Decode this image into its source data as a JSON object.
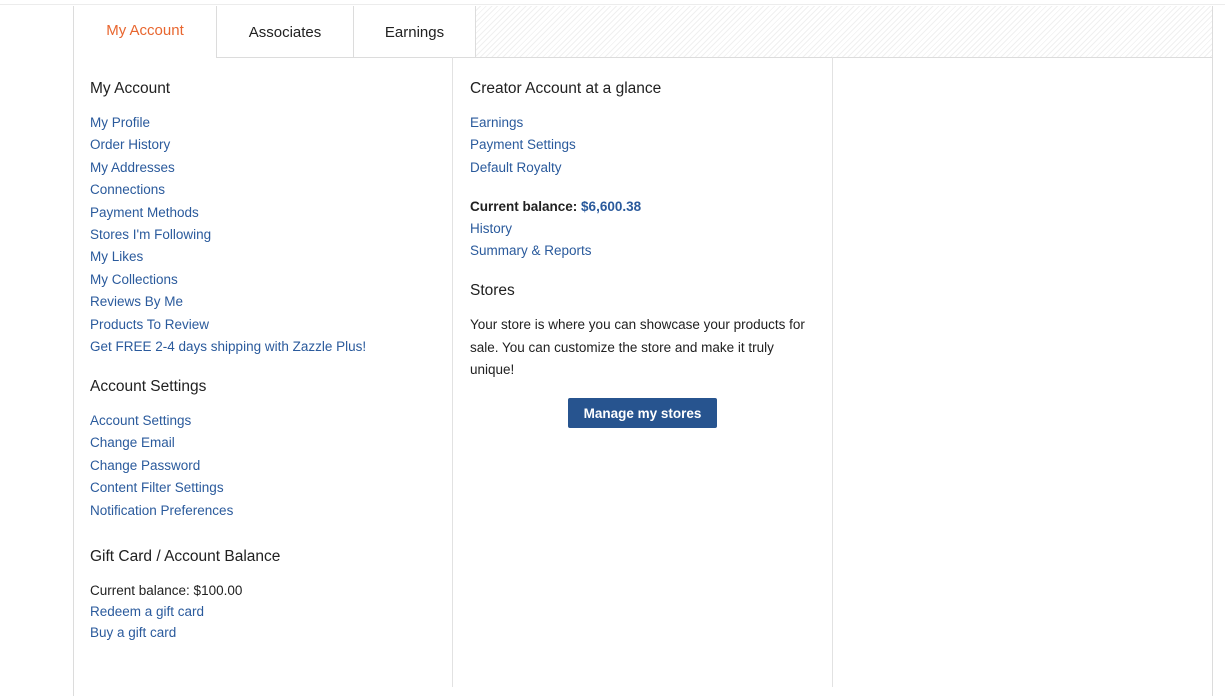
{
  "tabs": {
    "my_account": "My Account",
    "associates": "Associates",
    "earnings": "Earnings"
  },
  "my_account": {
    "heading": "My Account",
    "links": [
      "My Profile",
      "Order History",
      "My Addresses",
      "Connections",
      "Payment Methods",
      "Stores I'm Following",
      "My Likes",
      "My Collections",
      "Reviews By Me",
      "Products To Review",
      "Get FREE 2-4 days shipping with Zazzle Plus!"
    ]
  },
  "account_settings": {
    "heading": "Account Settings",
    "links": [
      "Account Settings",
      "Change Email",
      "Change Password",
      "Content Filter Settings",
      "Notification Preferences"
    ]
  },
  "gift_card": {
    "heading": "Gift Card / Account Balance",
    "balance_text": "Current balance: $100.00",
    "links": [
      "Redeem a gift card",
      "Buy a gift card"
    ]
  },
  "creator": {
    "heading": "Creator Account at a glance",
    "links": [
      "Earnings",
      "Payment Settings",
      "Default Royalty"
    ],
    "balance_label": "Current balance:",
    "balance_value": "$6,600.38",
    "balance_links": [
      "History",
      "Summary & Reports"
    ]
  },
  "stores": {
    "heading": "Stores",
    "description": "Your store is where you can showcase your products for sale. You can customize the store and make it truly unique!",
    "button_label": "Manage my stores"
  },
  "colors": {
    "accent_tab": "#e8662f",
    "link": "#2a5a9c",
    "button_bg": "#27548f"
  }
}
